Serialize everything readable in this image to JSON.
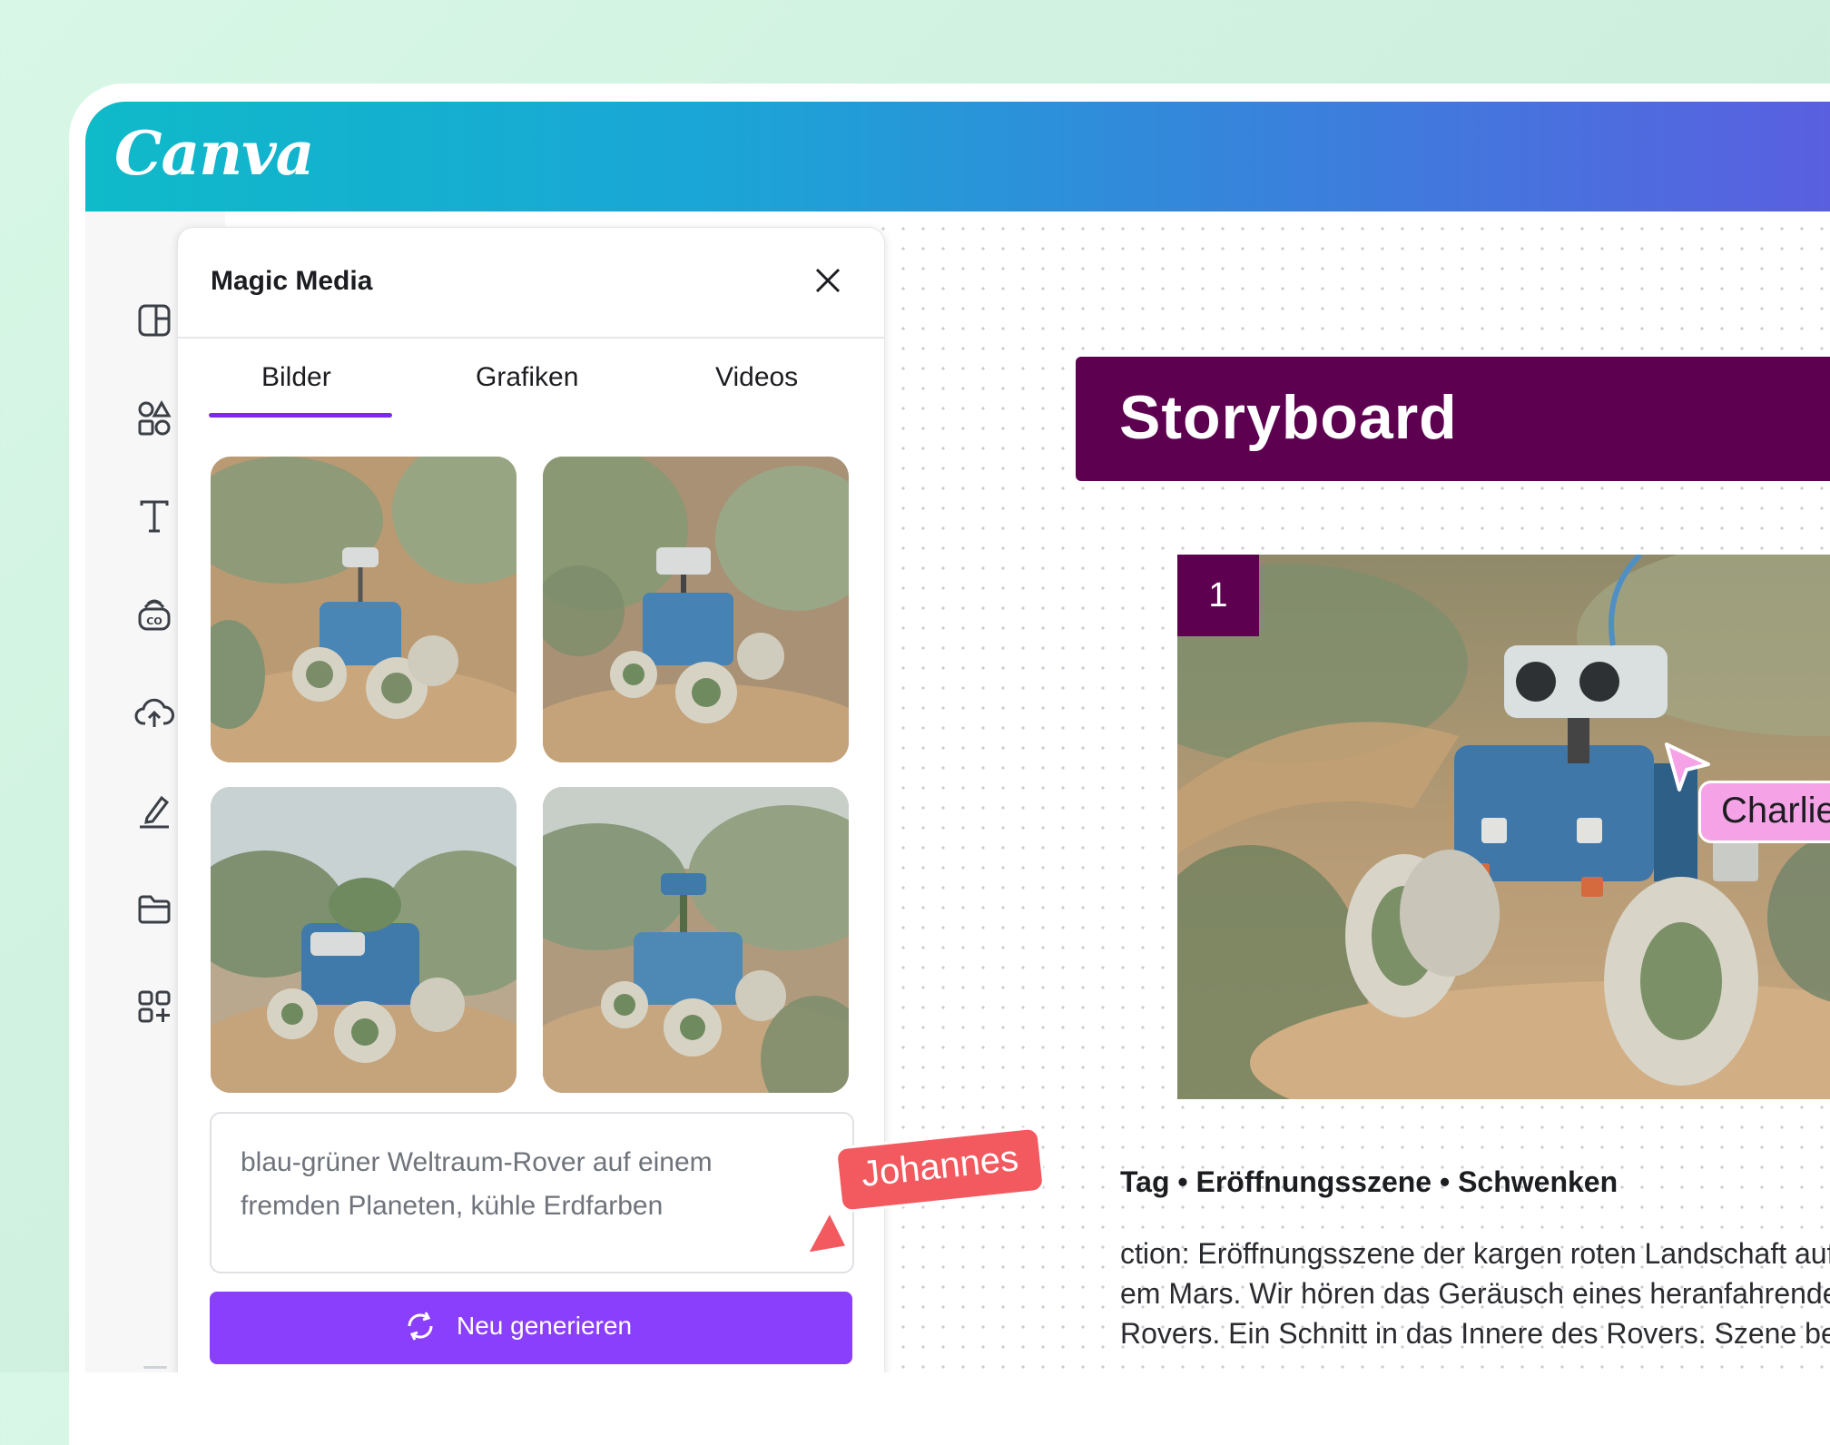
{
  "app": {
    "logo": "Canva"
  },
  "sidebar": {
    "items": [
      {
        "icon": "layout-icon"
      },
      {
        "icon": "elements-icon"
      },
      {
        "icon": "text-icon"
      },
      {
        "icon": "brand-icon"
      },
      {
        "icon": "upload-cloud-icon"
      },
      {
        "icon": "draw-icon"
      },
      {
        "icon": "folder-icon"
      },
      {
        "icon": "apps-icon"
      }
    ]
  },
  "panel": {
    "title": "Magic Media",
    "tabs": [
      {
        "label": "Bilder",
        "active": true
      },
      {
        "label": "Grafiken",
        "active": false
      },
      {
        "label": "Videos",
        "active": false
      }
    ],
    "prompt": "blau-grüner Weltraum-Rover auf einem fremden Planeten, kühle Erdfarben",
    "generate_label": "Neu generieren"
  },
  "canvas": {
    "title": "Storyboard",
    "scene_number": "1",
    "scene_meta": "Tag • Eröffnungsszene • Schwenken",
    "description_lines": [
      "ction: Eröffnungsszene der kargen roten Landschaft auf",
      "em Mars. Wir hören das Geräusch eines heranfahrenden",
      "Rovers. Ein Schnitt in das Innere des Rovers. Szene beenc"
    ]
  },
  "collaborators": [
    {
      "name": "Johannes",
      "color": "#f25a60"
    },
    {
      "name": "Charlie",
      "color": "#f5a3e6"
    }
  ],
  "colors": {
    "accent": "#7d2ae8",
    "button": "#8a3ffc",
    "banner": "#5e0050"
  }
}
